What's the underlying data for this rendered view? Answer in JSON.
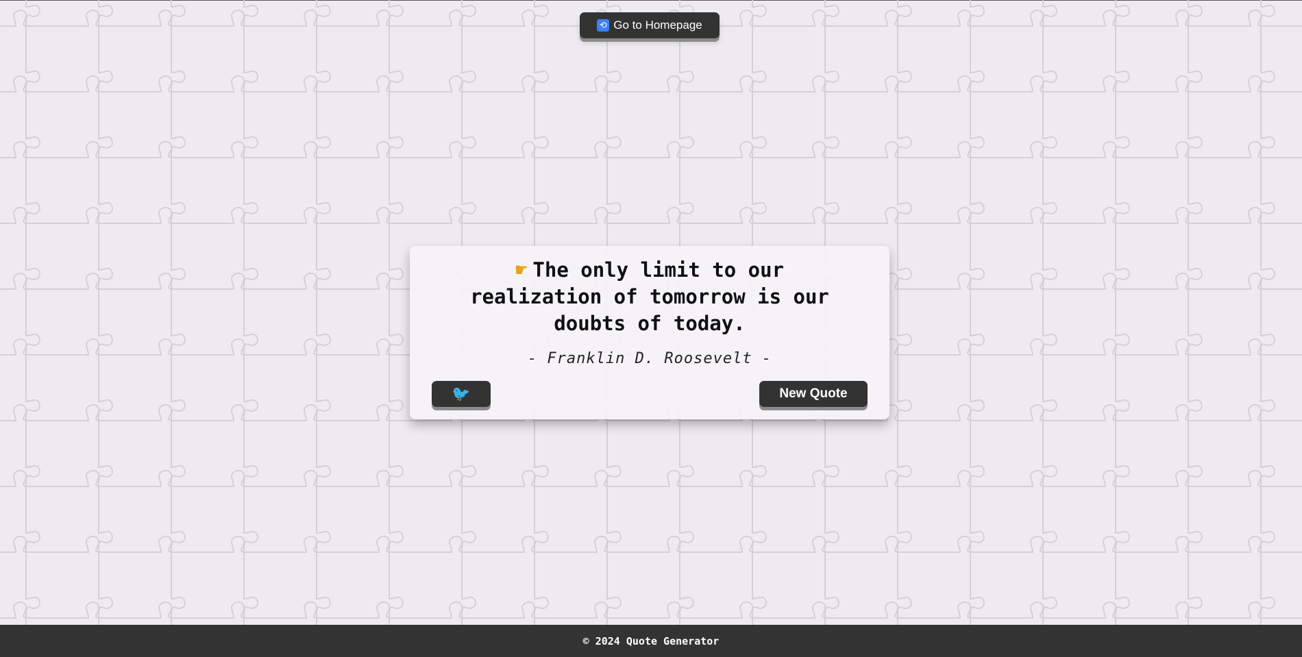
{
  "nav": {
    "home_button_label": "Go to Homepage",
    "home_icon": "back-arrow-icon"
  },
  "quote": {
    "icon": "pointing-hand-icon",
    "text": "The only limit to our realization of tomorrow is our doubts of today.",
    "author": "- Franklin D. Roosevelt -"
  },
  "actions": {
    "tweet_icon": "twitter-bird-icon",
    "new_quote_label": "New Quote"
  },
  "footer": {
    "text": "© 2024 Quote Generator"
  },
  "colors": {
    "background": "#edebf0",
    "button": "#333333",
    "footer": "#333333",
    "puzzle_lines": "#d6d3da"
  }
}
